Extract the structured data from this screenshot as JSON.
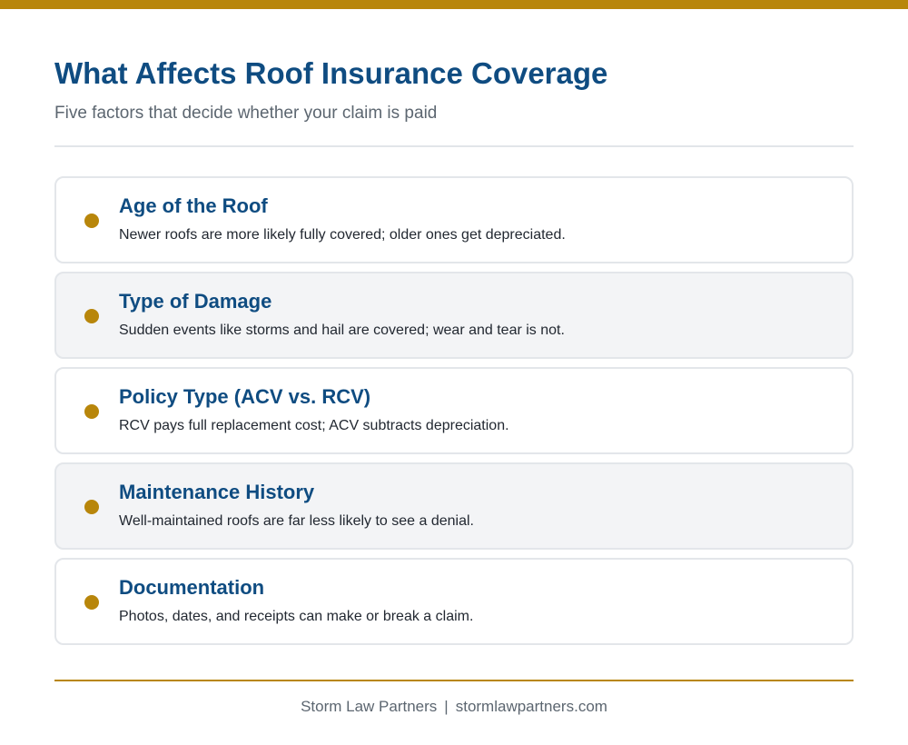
{
  "header": {
    "title": "What Affects Roof Insurance Coverage",
    "subtitle": "Five factors that decide whether your claim is paid"
  },
  "factors": [
    {
      "title": "Age of the Roof",
      "description": "Newer roofs are more likely fully covered; older ones get depreciated."
    },
    {
      "title": "Type of Damage",
      "description": "Sudden events like storms and hail are covered; wear and tear is not."
    },
    {
      "title": "Policy Type (ACV vs. RCV)",
      "description": "RCV pays full replacement cost; ACV subtracts depreciation."
    },
    {
      "title": "Maintenance History",
      "description": "Well-maintained roofs are far less likely to see a denial."
    },
    {
      "title": "Documentation",
      "description": "Photos, dates, and receipts can make or break a claim."
    }
  ],
  "footer": {
    "company": "Storm Law Partners",
    "separator": "|",
    "website": "stormlawpartners.com"
  },
  "colors": {
    "accent": "#b8860b",
    "heading": "#0f4c81",
    "muted": "#5c6670"
  }
}
